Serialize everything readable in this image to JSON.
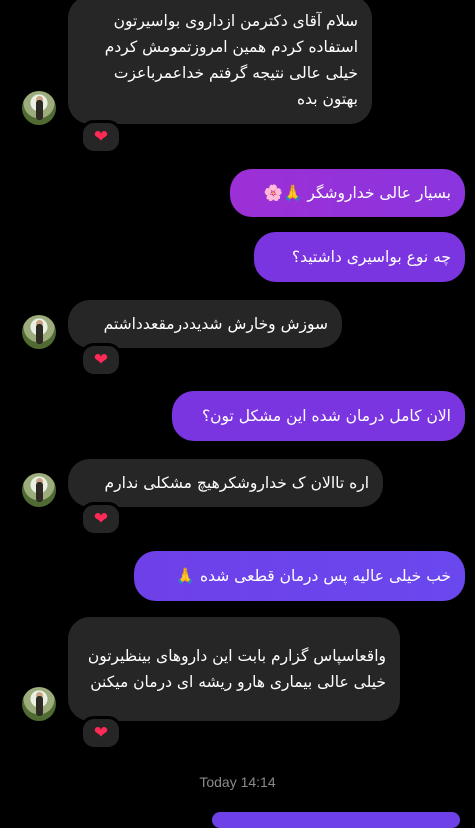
{
  "messages": [
    {
      "type": "received",
      "text": "سلام آقای دکترمن ازداروی بواسیرتون استفاده کردم همین امروزتمومش کردم خیلی عالی نتیجه گرفتم خداعمرباعزت بهتون بده",
      "reaction": "❤"
    },
    {
      "type": "sent",
      "text": "بسیار عالی خداروشگر 🙏🌸"
    },
    {
      "type": "sent",
      "text": "چه نوع بواسیری داشتید؟"
    },
    {
      "type": "received",
      "text": "سوزش وخارش شدیددرمقعدداشتم",
      "reaction": "❤"
    },
    {
      "type": "sent",
      "text": "الان کامل درمان شده این مشکل تون؟"
    },
    {
      "type": "received",
      "text": "اره تاالان ک خداروشکرهیچ مشکلی ندارم",
      "reaction": "❤"
    },
    {
      "type": "sent",
      "text": "خب خیلی عالیه پس درمان قطعی شده 🙏"
    },
    {
      "type": "received",
      "text": "واقعاسپاس گزارم بابت این داروهای بینظیرتون خیلی عالی بیماری هارو ریشه ای درمان میکنن",
      "reaction": "❤"
    }
  ],
  "timestamp": "Today 14:14"
}
